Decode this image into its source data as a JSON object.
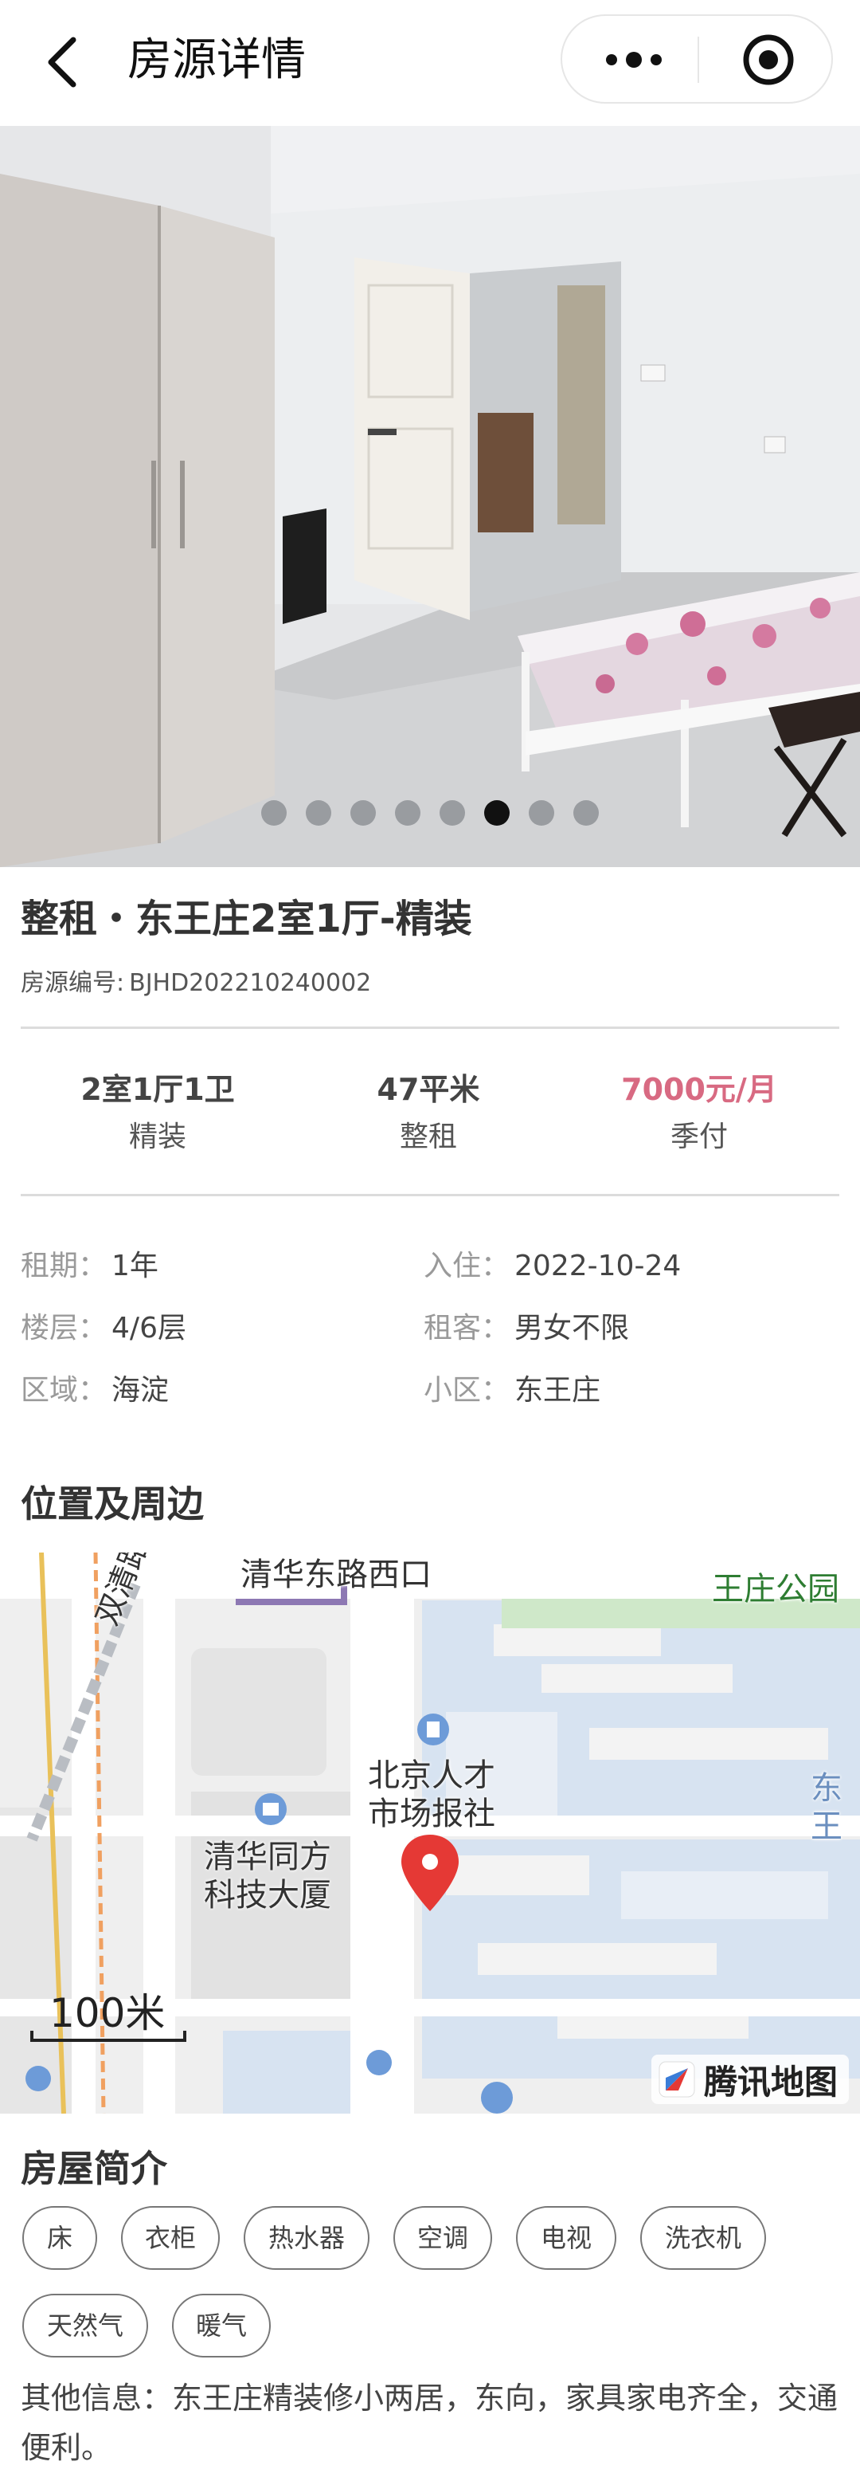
{
  "header": {
    "title": "房源详情",
    "back_icon": "chevron-left-icon",
    "more_icon": "more-dots-icon",
    "close_icon": "target-circle-icon"
  },
  "gallery": {
    "photo_count": 8,
    "active_index": 5
  },
  "listing": {
    "title": "整租・东王庄2室1厅-精装",
    "id_label": "房源编号:",
    "id_value": "BJHD202210240002"
  },
  "summary": [
    {
      "value": "2室1厅1卫",
      "sub": "精装"
    },
    {
      "value": "47平米",
      "sub": "整租"
    },
    {
      "value": "7000元/月",
      "sub": "季付"
    }
  ],
  "details": {
    "lease_key": "租期",
    "lease_value": "1年",
    "movein_key": "入住",
    "movein_value": "2022-10-24",
    "floor_key": "楼层",
    "floor_value": "4/6层",
    "tenant_key": "租客",
    "tenant_value": "男女不限",
    "district_key": "区域",
    "district_value": "海淀",
    "community_key": "小区",
    "community_value": "东王庄",
    "colon": "："
  },
  "location": {
    "section_title": "位置及周边",
    "map_labels": {
      "road_west": "清华东路西口",
      "park": "王庄公园",
      "shuangqing": "双清路",
      "rencai_1": "北京人才",
      "rencai_2": "市场报社",
      "tongfang_1": "清华同方",
      "tongfang_2": "科技大厦",
      "dong": "东王"
    },
    "scale": "100米",
    "brand": "腾讯地图"
  },
  "intro": {
    "section_title": "房屋简介",
    "tags": [
      "床",
      "衣柜",
      "热水器",
      "空调",
      "电视",
      "洗衣机",
      "天然气",
      "暖气"
    ],
    "other_info": "其他信息：东王庄精装修小两居，东向，家具家电齐全，交通便利。"
  },
  "colors": {
    "price": "#d86a82",
    "map_marker": "#e53935",
    "active_dot": "#111111"
  }
}
